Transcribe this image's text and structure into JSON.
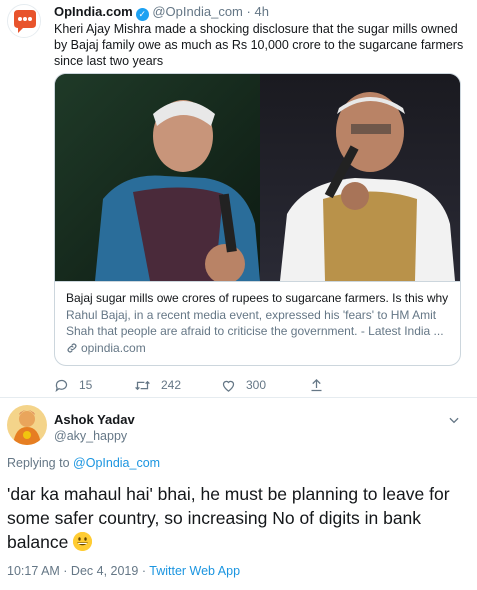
{
  "original_tweet": {
    "author_name": "OpIndia.com",
    "author_handle": "@OpIndia_com",
    "separator": "·",
    "timestamp": "4h",
    "text": "Kheri Ajay Mishra made a shocking disclosure that the sugar mills owned by Bajaj family owe as much as Rs 10,000 crore to the sugarcane farmers since last two years",
    "card": {
      "title": "Bajaj sugar mills owe crores of rupees to sugarcane farmers. Is this why ...",
      "description": "Rahul Bajaj, in a recent media event, expressed his 'fears' to HM Amit Shah that people are afraid to criticise the government. - Latest India ...",
      "domain": "opindia.com"
    },
    "actions": {
      "replies": "15",
      "retweets": "242",
      "likes": "300"
    }
  },
  "reply_tweet": {
    "author_name": "Ashok Yadav",
    "author_handle": "@aky_happy",
    "replying_prefix": "Replying to",
    "replying_to": "@OpIndia_com",
    "text": "'dar ka mahaul hai' bhai, he must be planning to leave for some safer country, so increasing No of digits in bank balance",
    "emoji": "grinning-face",
    "timestamp": "10:17 AM · Dec 4, 2019",
    "separator": "·",
    "source": "Twitter Web App"
  },
  "colors": {
    "link": "#1b95e0",
    "secondary_text": "#657786",
    "border": "#ccd6dd",
    "verified": "#1da1f2",
    "opindia_brand": "#e8542c"
  }
}
